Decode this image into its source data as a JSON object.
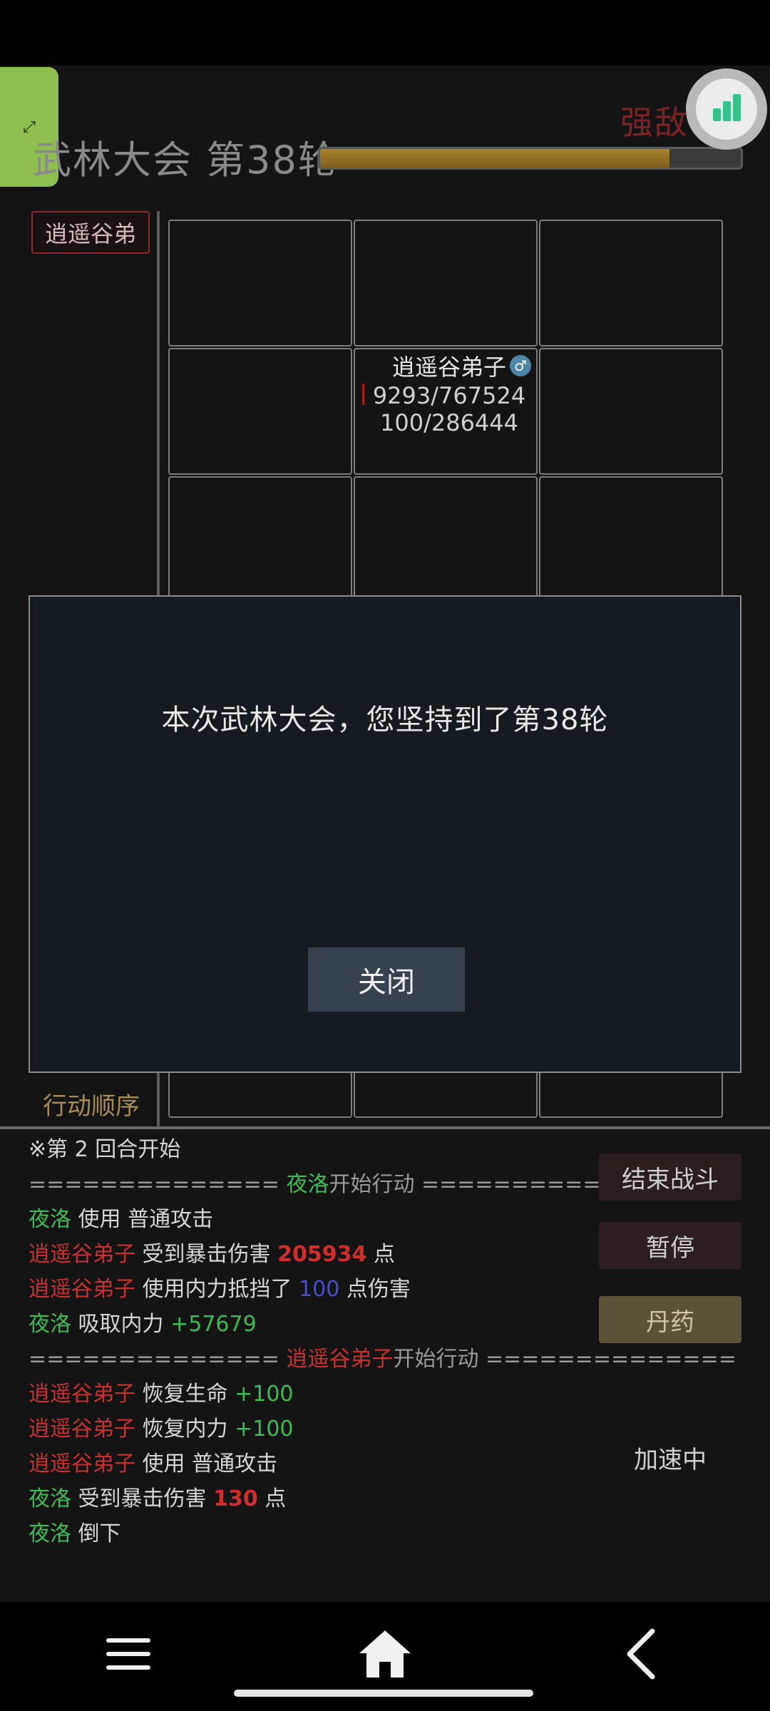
{
  "header": {
    "title": "武林大会 第38轮",
    "enemy_label": "强敌",
    "progress": 0.83,
    "expand_icon": "expand-arrows-icon",
    "float_icon": "bar-chart-icon"
  },
  "board": {
    "side_tag": "逍遥谷弟",
    "fighter": {
      "name": "逍遥谷弟子",
      "gender_icon": "♂",
      "hp": "9293/767524",
      "mp": "100/286444"
    },
    "order_label": "行动顺序"
  },
  "modal": {
    "message": "本次武林大会，您坚持到了第38轮",
    "close_label": "关闭"
  },
  "log": {
    "round_start": "※第 2 回合开始",
    "dashes": "==============",
    "actor1": "夜洛",
    "actor2": "逍遥谷弟子",
    "start_action": "开始行动",
    "use": "使用",
    "normal_attack": "普通攻击",
    "crit_damage": "受到暴击伤害",
    "dmg1": "205934",
    "point": "点",
    "neili_block": "使用内力抵挡了",
    "block_value": "100",
    "point_damage": "点伤害",
    "absorb": "吸取内力",
    "absorb_value": "+57679",
    "restore_hp": "恢复生命",
    "restore_mp": "恢复内力",
    "restore_value": "+100",
    "dmg2": "130",
    "fall": "倒下"
  },
  "side_buttons": {
    "end_battle": "结束战斗",
    "pause": "暂停",
    "pill": "丹药",
    "speed_status": "加速中"
  },
  "nav": {
    "menu_icon": "menu-icon",
    "home_icon": "home-icon",
    "back_icon": "back-icon"
  }
}
